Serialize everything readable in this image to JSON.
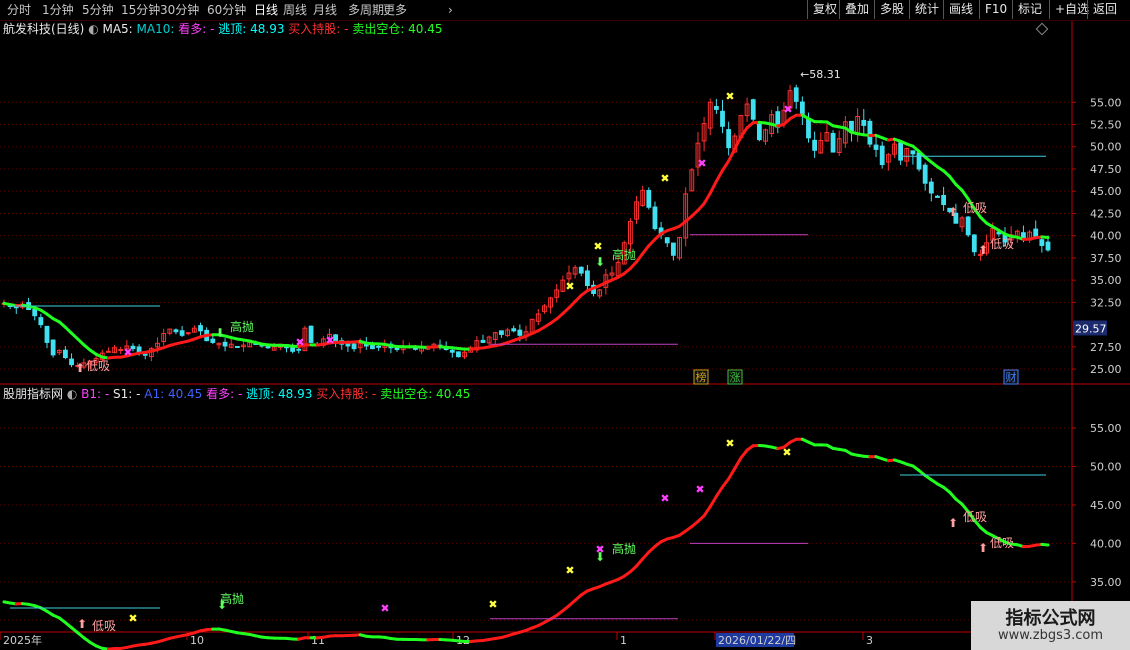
{
  "toolbar": {
    "periods": [
      "分时",
      "1分钟",
      "5分钟",
      "15分钟",
      "30分钟",
      "60分钟",
      "日线",
      "周线",
      "月线",
      "多周期",
      "更多"
    ],
    "active_period": "日线",
    "right_buttons": [
      "复权",
      "叠加",
      "多股",
      "统计",
      "画线",
      "F10",
      "标记",
      "+自选",
      "返回"
    ]
  },
  "main_header": {
    "stock_name": "航发科技(日线)",
    "items": [
      {
        "text": "MA5:",
        "color": "#e8e8e8"
      },
      {
        "text": "MA10:",
        "color": "#00d0d0"
      },
      {
        "text": "看多: -",
        "color": "#ff40ff"
      },
      {
        "text": "逃顶: 48.93",
        "color": "#00ffff"
      },
      {
        "text": "买入持股: -",
        "color": "#ff3030"
      },
      {
        "text": "卖出空仓: 40.45",
        "color": "#20ff20"
      }
    ]
  },
  "indicator_header": {
    "name": "股朋指标网",
    "items": [
      {
        "text": "B1: -",
        "color": "#ff40ff"
      },
      {
        "text": "S1: -",
        "color": "#e8e8e8"
      },
      {
        "text": "A1: 40.45",
        "color": "#4060ff"
      },
      {
        "text": "看多: -",
        "color": "#ff40ff"
      },
      {
        "text": "逃顶: 48.93",
        "color": "#00ffff"
      },
      {
        "text": "买入持股: -",
        "color": "#ff3030"
      },
      {
        "text": "卖出空仓: 40.45",
        "color": "#20ff20"
      }
    ]
  },
  "colors": {
    "up": "#ff3030",
    "down": "#40e0f0",
    "bull": "#ff1a1a",
    "bear": "#20ff20",
    "grid": "#5a0000",
    "axis": "#c00000"
  },
  "chart_data": [
    {
      "type": "candlestick",
      "title": "航发科技(日线)",
      "ylim": [
        24,
        62
      ],
      "yticks": [
        "55.00",
        "52.50",
        "50.00",
        "47.50",
        "45.00",
        "42.50",
        "40.00",
        "37.50",
        "35.00",
        "32.50",
        "27.50",
        "25.00"
      ],
      "current_price": "29.57",
      "high_label": "58.31",
      "closes": [
        32.4,
        32.1,
        31.9,
        32.3,
        31.7,
        31.0,
        30.0,
        28.0,
        26.6,
        27.1,
        26.3,
        25.5,
        25.4,
        25.7,
        25.9,
        26.2,
        26.8,
        27.0,
        27.4,
        27.2,
        27.6,
        27.3,
        26.8,
        26.6,
        27.3,
        27.9,
        29.0,
        29.5,
        29.2,
        28.8,
        29.1,
        29.6,
        29.3,
        28.2,
        28.0,
        27.9,
        27.6,
        27.8,
        27.5,
        27.7,
        28.0,
        27.8,
        27.6,
        27.4,
        27.5,
        27.8,
        27.4,
        27.0,
        27.2,
        29.6,
        28.0,
        27.6,
        28.4,
        28.9,
        28.1,
        27.8,
        27.6,
        27.3,
        27.9,
        27.6,
        27.3,
        27.5,
        27.8,
        27.4,
        27.2,
        27.6,
        27.5,
        27.3,
        27.5,
        27.4,
        27.8,
        27.6,
        27.2,
        26.9,
        26.4,
        26.9,
        27.4,
        28.2,
        28.0,
        28.6,
        29.1,
        28.9,
        29.4,
        29.3,
        28.8,
        29.2,
        30.6,
        31.2,
        32.1,
        33.0,
        33.9,
        35.0,
        35.8,
        36.4,
        35.8,
        34.4,
        33.5,
        33.9,
        35.6,
        35.8,
        37.0,
        39.2,
        41.6,
        43.8,
        45.1,
        43.2,
        40.8,
        40.1,
        39.2,
        37.8,
        39.8,
        44.7,
        47.4,
        50.4,
        52.6,
        55.0,
        54.2,
        52.3,
        49.9,
        51.2,
        53.5,
        54.8,
        53.1,
        50.8,
        51.9,
        53.6,
        52.2,
        54.1,
        56.3,
        55.1,
        53.6,
        51.0,
        49.6,
        50.7,
        51.6,
        49.4,
        50.9,
        52.8,
        51.6,
        53.4,
        52.4,
        50.3,
        49.7,
        48.0,
        49.1,
        50.3,
        48.5,
        49.8,
        49.2,
        47.5,
        45.9,
        44.8,
        44.3,
        43.5,
        42.7,
        41.4,
        42.0,
        40.1,
        38.2,
        37.9,
        39.2,
        40.8,
        40.2,
        39.3,
        40.1,
        40.5,
        39.6,
        40.4,
        39.7,
        38.9,
        38.4
      ],
      "ma_line_end": 40.45,
      "escape_top_line": 48.93,
      "annotations": [
        "高抛",
        "高抛",
        "低吸",
        "低吸",
        "低吸"
      ],
      "date_badges": [
        "榜",
        "涨",
        "财"
      ]
    },
    {
      "type": "line",
      "title": "股朋指标网",
      "ylim": [
        29,
        58
      ],
      "yticks": [
        "55.00",
        "50.00",
        "45.00",
        "40.00",
        "35.00",
        "30.00"
      ],
      "series": [
        {
          "name": "卖出空仓",
          "values": [
            40.45
          ]
        }
      ],
      "annotations": [
        "高抛",
        "高抛",
        "低吸",
        "低吸",
        "低吸"
      ]
    }
  ],
  "xaxis": {
    "labels": [
      "2025年",
      "10",
      "11",
      "12",
      "1",
      "2026/01/22/四",
      "3"
    ]
  },
  "watermark": {
    "title": "指标公式网",
    "url": "www.zbgs3.com"
  }
}
